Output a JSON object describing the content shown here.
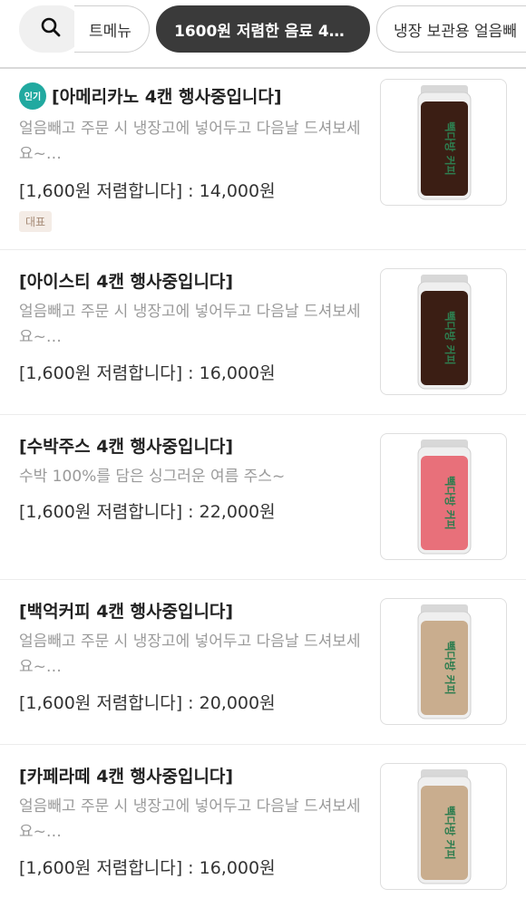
{
  "filters": {
    "search_icon": "search-icon",
    "chips": [
      {
        "label": "트메뉴",
        "active": false
      },
      {
        "label": "1600원 저렴한 음료 4…",
        "active": true
      },
      {
        "label": "냉장 보관용 얼음빼",
        "active": false
      }
    ]
  },
  "menu": [
    {
      "badge": "인기",
      "title": "[아메리카노 4캔 행사중입니다]",
      "description": "얼음빼고 주문 시 냉장고에 넣어두고 다음날 드셔보세요~…",
      "price": "[1,600원 저렴합니다] : 14,000원",
      "tag": "대표",
      "can_logo": "빽다방 커피",
      "liquid_color": "#3b1e14"
    },
    {
      "title": "[아이스티 4캔 행사중입니다]",
      "description": "얼음빼고 주문 시 냉장고에 넣어두고 다음날 드셔보세요~…",
      "price": "[1,600원 저렴합니다] : 16,000원",
      "can_logo": "빽다방 커피",
      "liquid_color": "#3b1e14"
    },
    {
      "title": "[수박주스 4캔 행사중입니다]",
      "description": "수박 100%를 담은 싱그러운 여름 주스~",
      "price": "[1,600원 저렴합니다] : 22,000원",
      "can_logo": "빽다방 커피",
      "liquid_color": "#e8707a"
    },
    {
      "title": "[백억커피 4캔 행사중입니다]",
      "description": "얼음빼고 주문 시 냉장고에 넣어두고 다음날 드셔보세요~…",
      "price": "[1,600원 저렴합니다] : 20,000원",
      "can_logo": "빽다방 커피",
      "liquid_color": "#c9ad8e"
    },
    {
      "title": "[카페라떼 4캔 행사중입니다]",
      "description": "얼음빼고 주문 시 냉장고에 넣어두고 다음날 드셔보세요~…",
      "price": "[1,600원 저렴합니다] : 16,000원",
      "can_logo": "빽다방 커피",
      "liquid_color": "#c9ad8e"
    }
  ]
}
